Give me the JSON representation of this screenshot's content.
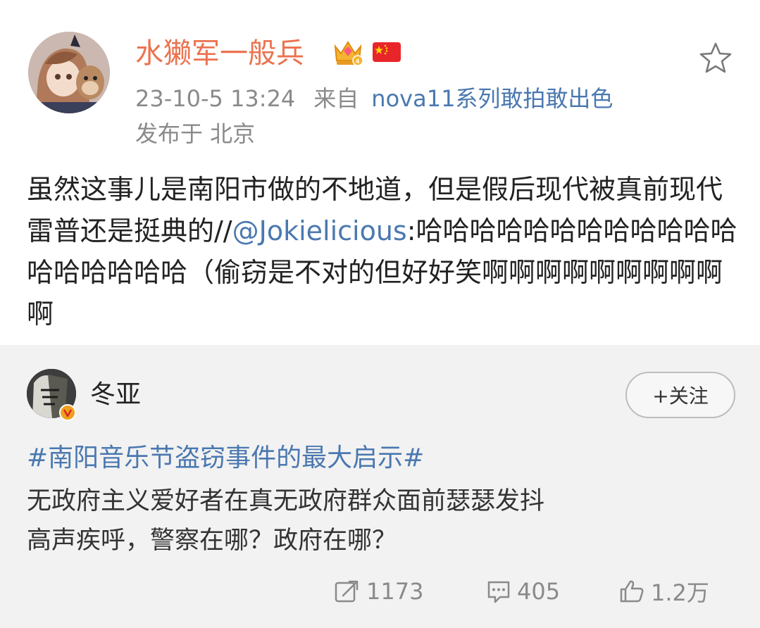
{
  "post": {
    "username": "水獭军一般兵",
    "timestamp": "23-10-5 13:24",
    "from_label": "来自",
    "source": "nova11系列敢拍敢出色",
    "location": "发布于 北京",
    "text_part1": "虽然这事儿是南阳市做的不地道，但是假后现代被真前现代雷普还是挺典的//",
    "mention": "@Jokielicious",
    "text_part2": ":哈哈哈哈哈哈哈哈哈哈哈哈哈哈哈哈哈哈（偷窃是不对的但好好笑啊啊啊啊啊啊啊啊啊啊",
    "icons": {
      "badge": "vip-crown-icon",
      "flag": "china-flag-icon",
      "favorite": "star-icon"
    }
  },
  "repost": {
    "username": "冬亚",
    "follow_label": "+关注",
    "topic": "#南阳音乐节盗窃事件的最大启示#",
    "line1": "无政府主义爱好者在真无政府群众面前瑟瑟发抖",
    "line2": "高声疾呼，警察在哪？政府在哪？",
    "stats": {
      "reposts": "1173",
      "comments": "405",
      "likes": "1.2万"
    }
  },
  "colors": {
    "username": "#eb7350",
    "link": "#4a78b0",
    "meta": "#8a8a8a",
    "repost_bg": "#f2f2f2"
  }
}
